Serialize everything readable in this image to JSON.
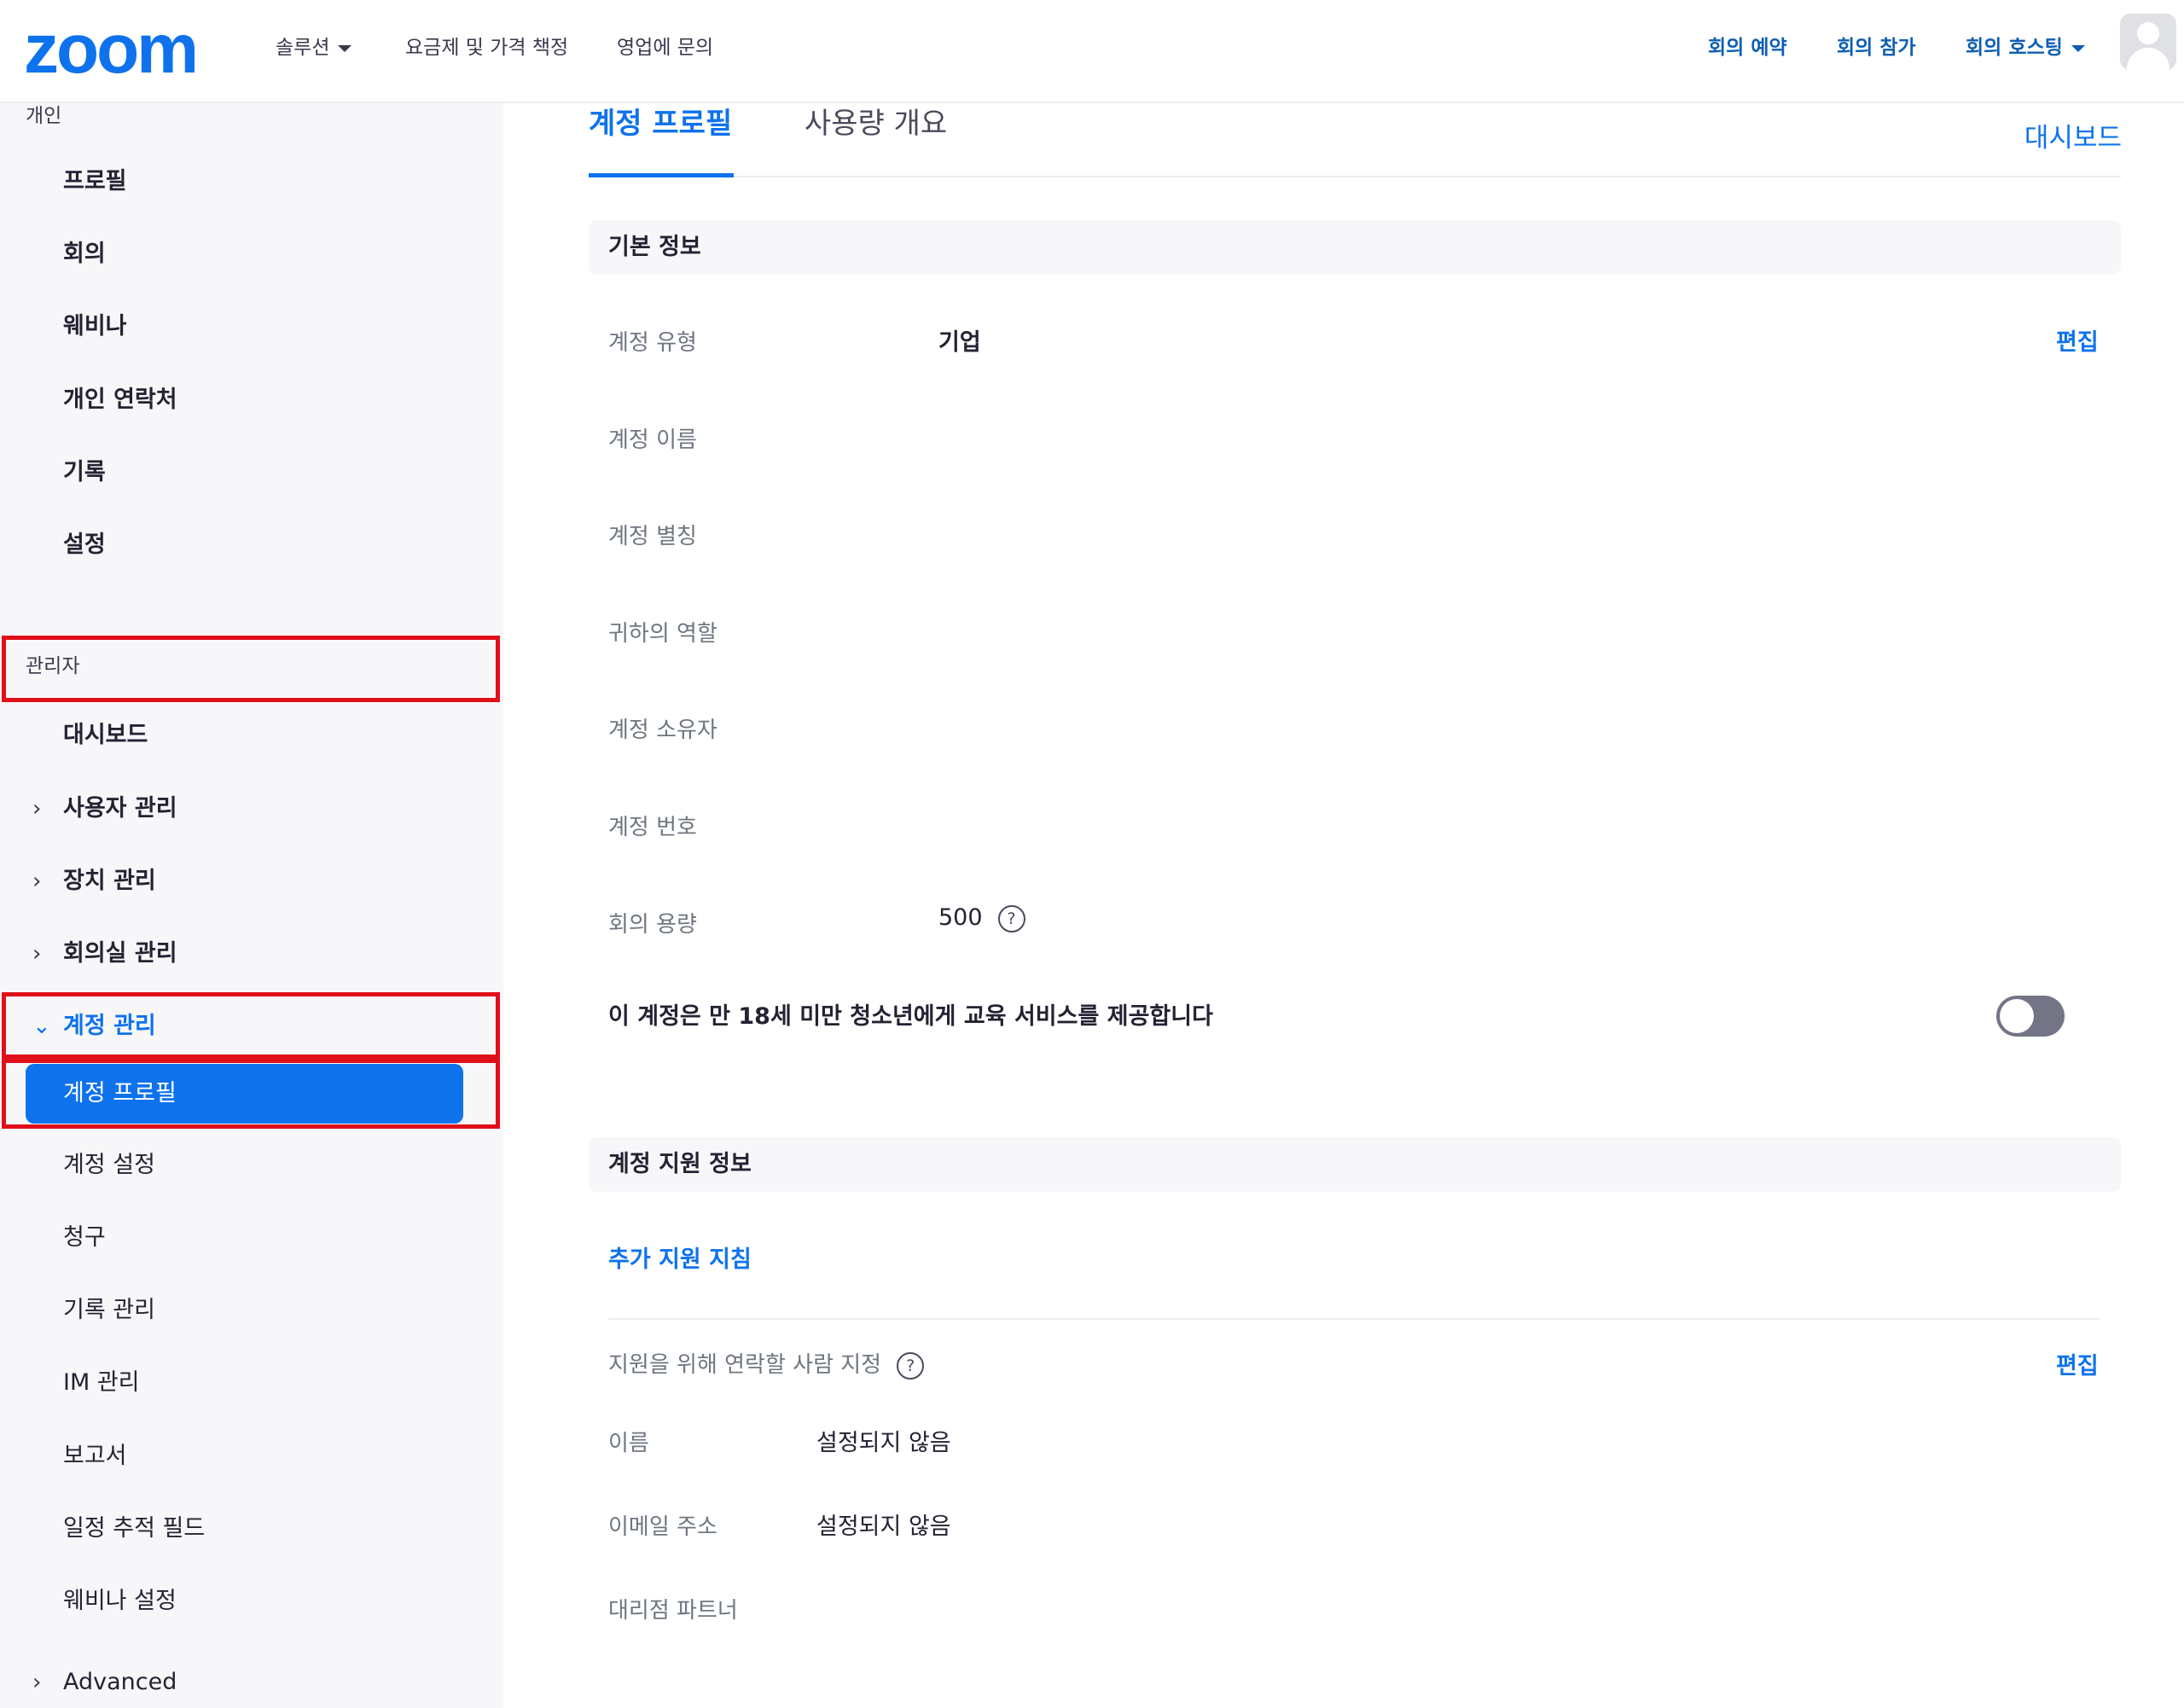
{
  "header": {
    "logo": "zoom",
    "nav": [
      {
        "label": "솔루션",
        "has_caret": true
      },
      {
        "label": "요금제 및 가격 책정"
      },
      {
        "label": "영업에 문의"
      }
    ],
    "right_nav": [
      {
        "label": "회의 예약"
      },
      {
        "label": "회의 참가"
      },
      {
        "label": "회의 호스팅",
        "has_caret": true
      }
    ],
    "avatar": "user-avatar-icon"
  },
  "sidebar": {
    "personal_section": "개인",
    "personal_items": [
      "프로필",
      "회의",
      "웨비나",
      "개인 연락처",
      "기록",
      "설정"
    ],
    "admin_section": "관리자",
    "admin_items": [
      {
        "label": "대시보드"
      },
      {
        "label": "사용자 관리",
        "chevron": "chevron-right-icon"
      },
      {
        "label": "장치 관리",
        "chevron": "chevron-right-icon"
      },
      {
        "label": "회의실 관리",
        "chevron": "chevron-right-icon"
      },
      {
        "label": "계정 관리",
        "chevron": "chevron-down-icon",
        "expanded": true
      }
    ],
    "active_item": "계정 프로필",
    "sub_items": [
      "계정 설정",
      "청구",
      "기록 관리",
      "IM 관리",
      "보고서",
      "일정 추적 필드",
      "웨비나 설정"
    ],
    "advanced": "Advanced",
    "highlight_color": "#e0101b"
  },
  "main": {
    "tabs": [
      {
        "label": "계정 프로필",
        "active": true
      },
      {
        "label": "사용량 개요",
        "active": false
      }
    ],
    "dashboard_link": "대시보드",
    "basic_info": {
      "title": "기본 정보",
      "fields": [
        {
          "label": "계정 유형",
          "value": "기업"
        },
        {
          "label": "계정 이름",
          "value": ""
        },
        {
          "label": "계정 별칭",
          "value": ""
        },
        {
          "label": "귀하의 역할",
          "value": ""
        },
        {
          "label": "계정 소유자",
          "value": ""
        },
        {
          "label": "계정 번호",
          "value": ""
        },
        {
          "label": "회의 용량",
          "value": "500"
        }
      ],
      "edit_label": "편집",
      "help_icon": "?",
      "education_text": "이 계정은 만 18세 미만 청소년에게 교육 서비스를 제공합니다",
      "education_toggle_on": false
    },
    "support_info": {
      "title": "계정 지원 정보",
      "extra_link": "추가 지원 지침",
      "contact_label": "지원을 위해 연락할 사람 지정",
      "edit_label": "편집",
      "help_icon": "?",
      "fields": [
        {
          "label": "이름",
          "value": "설정되지 않음"
        },
        {
          "label": "이메일 주소",
          "value": "설정되지 않음"
        },
        {
          "label": "대리점 파트너",
          "value": ""
        }
      ]
    },
    "accent_color": "#0e72ed"
  }
}
